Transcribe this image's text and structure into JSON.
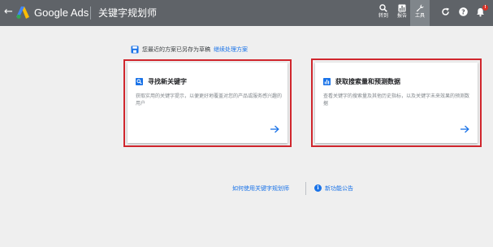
{
  "header": {
    "back_icon": "arrow-back-icon",
    "brand": "Google Ads",
    "page_title": "关键字规划师",
    "tools": [
      {
        "label": "转到",
        "icon": "search-icon"
      },
      {
        "label": "报告",
        "icon": "report-icon"
      },
      {
        "label": "工具",
        "icon": "wrench-icon",
        "active": true
      }
    ],
    "right_icons": [
      "refresh-icon",
      "help-icon",
      "notifications-icon"
    ],
    "notification_badge": "!",
    "colors": {
      "bar": "#5f6368",
      "active_tool": "#80868b"
    }
  },
  "notice": {
    "icon": "save-icon",
    "text": "您最近的方案已另存为草稿",
    "link": "继续处理方案"
  },
  "cards": [
    {
      "icon": "search-icon",
      "title": "寻找新关键字",
      "description": "获取实用的关键字提示，以便更好地覆盖对您的产品或服务感兴趣的用户",
      "arrow_icon": "arrow-forward-icon"
    },
    {
      "icon": "chart-icon",
      "title": "获取搜索量和预测数据",
      "description": "查看关键字的搜索量及其他历史指标，以及关键字未来效果的预测数据",
      "arrow_icon": "arrow-forward-icon"
    }
  ],
  "footer": {
    "help_link": "如何使用关键字规划师",
    "info_icon": "info-icon",
    "news_link": "新功能公告"
  },
  "colors": {
    "accent": "#1a73e8",
    "highlight": "#d0262d",
    "background": "#efefef"
  }
}
